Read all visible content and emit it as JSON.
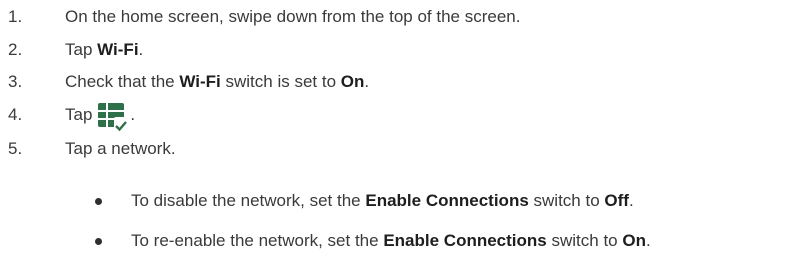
{
  "steps": [
    {
      "num": "1.",
      "text": "On the home screen, swipe down from the top of the screen."
    },
    {
      "num": "2.",
      "pre": "Tap ",
      "bold": "Wi-Fi",
      "post": "."
    },
    {
      "num": "3.",
      "pre": "Check that the ",
      "bold": "Wi-Fi",
      "mid": " switch is set to ",
      "bold2": "On",
      "post": "."
    },
    {
      "num": "4.",
      "pre": "Tap",
      "icon": "network-list-settings-icon",
      "post": "."
    },
    {
      "num": "5.",
      "text": "Tap a network."
    }
  ],
  "bullets": [
    {
      "pre": "To disable the network, set the ",
      "bold": "Enable Connections",
      "mid": " switch to ",
      "bold2": "Off",
      "post": "."
    },
    {
      "pre": "To re-enable the network, set the ",
      "bold": "Enable Connections",
      "mid": " switch to ",
      "bold2": "On",
      "post": "."
    }
  ],
  "colors": {
    "text": "#3a3a3a",
    "icon": "#2f6f4a"
  }
}
